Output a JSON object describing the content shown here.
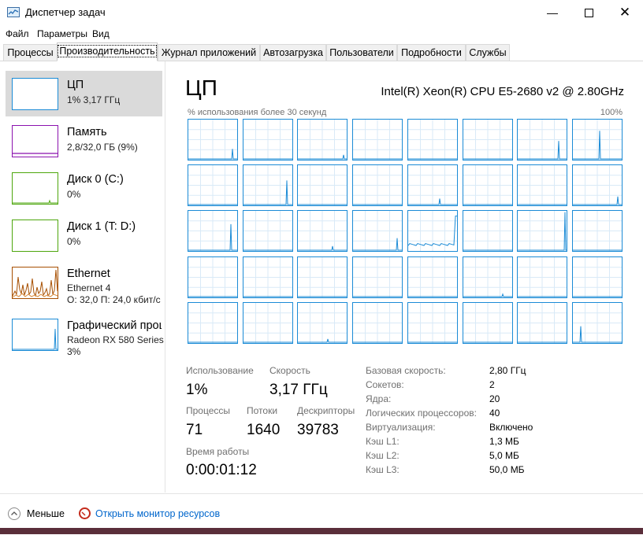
{
  "window": {
    "title": "Диспетчер задач",
    "icon": "task-manager-icon",
    "controls": [
      "minimize-icon",
      "maximize-icon",
      "close-icon"
    ]
  },
  "menu": [
    "Файл",
    "Параметры",
    "Вид"
  ],
  "tabs": [
    {
      "label": "Процессы",
      "active": false
    },
    {
      "label": "Производительность",
      "active": true
    },
    {
      "label": "Журнал приложений",
      "active": false
    },
    {
      "label": "Автозагрузка",
      "active": false
    },
    {
      "label": "Пользователи",
      "active": false
    },
    {
      "label": "Подробности",
      "active": false
    },
    {
      "label": "Службы",
      "active": false
    }
  ],
  "sidebar": {
    "items": [
      {
        "title": "ЦП",
        "line1": "1% 3,17 ГГц",
        "line2": "",
        "color": "#1b8bd6",
        "selected": true
      },
      {
        "title": "Память",
        "line1": "2,8/32,0 ГБ (9%)",
        "line2": "",
        "color": "#8b12ae",
        "selected": false
      },
      {
        "title": "Диск 0 (C:)",
        "line1": "0%",
        "line2": "",
        "color": "#4da60c",
        "selected": false
      },
      {
        "title": "Диск 1 (T: D:)",
        "line1": "0%",
        "line2": "",
        "color": "#4da60c",
        "selected": false
      },
      {
        "title": "Ethernet",
        "line1": "Ethernet 4",
        "line2": "О: 32,0 П: 24,0 кбит/с",
        "color": "#a74f01",
        "selected": false
      },
      {
        "title": "Графический проц",
        "line1": "Radeon RX 580 Series",
        "line2": "3%",
        "color": "#1b8bd6",
        "selected": false
      }
    ]
  },
  "main": {
    "title": "ЦП",
    "model": "Intel(R) Xeon(R) CPU E5-2680 v2 @ 2.80GHz",
    "axis_left": "% использования более 30 секунд",
    "axis_right": "100%",
    "graph_color": "#1b8bd6",
    "stats": {
      "usage_label": "Использование",
      "usage_value": "1%",
      "speed_label": "Скорость",
      "speed_value": "3,17 ГГц",
      "processes_label": "Процессы",
      "processes_value": "71",
      "threads_label": "Потоки",
      "threads_value": "1640",
      "handles_label": "Дескрипторы",
      "handles_value": "39783",
      "uptime_label": "Время работы",
      "uptime_value": "0:00:01:12"
    },
    "details": [
      {
        "label": "Базовая скорость:",
        "value": "2,80 ГГц"
      },
      {
        "label": "Сокетов:",
        "value": "2"
      },
      {
        "label": "Ядра:",
        "value": "20"
      },
      {
        "label": "Логических процессоров:",
        "value": "40"
      },
      {
        "label": "Виртуализация:",
        "value": "Включено"
      },
      {
        "label": "Кэш L1:",
        "value": "1,3 МБ"
      },
      {
        "label": "Кэш L2:",
        "value": "5,0 МБ"
      },
      {
        "label": "Кэш L3:",
        "value": "50,0 МБ"
      }
    ]
  },
  "footer": {
    "less_label": "Меньше",
    "resmon_label": "Открыть монитор ресурсов"
  }
}
